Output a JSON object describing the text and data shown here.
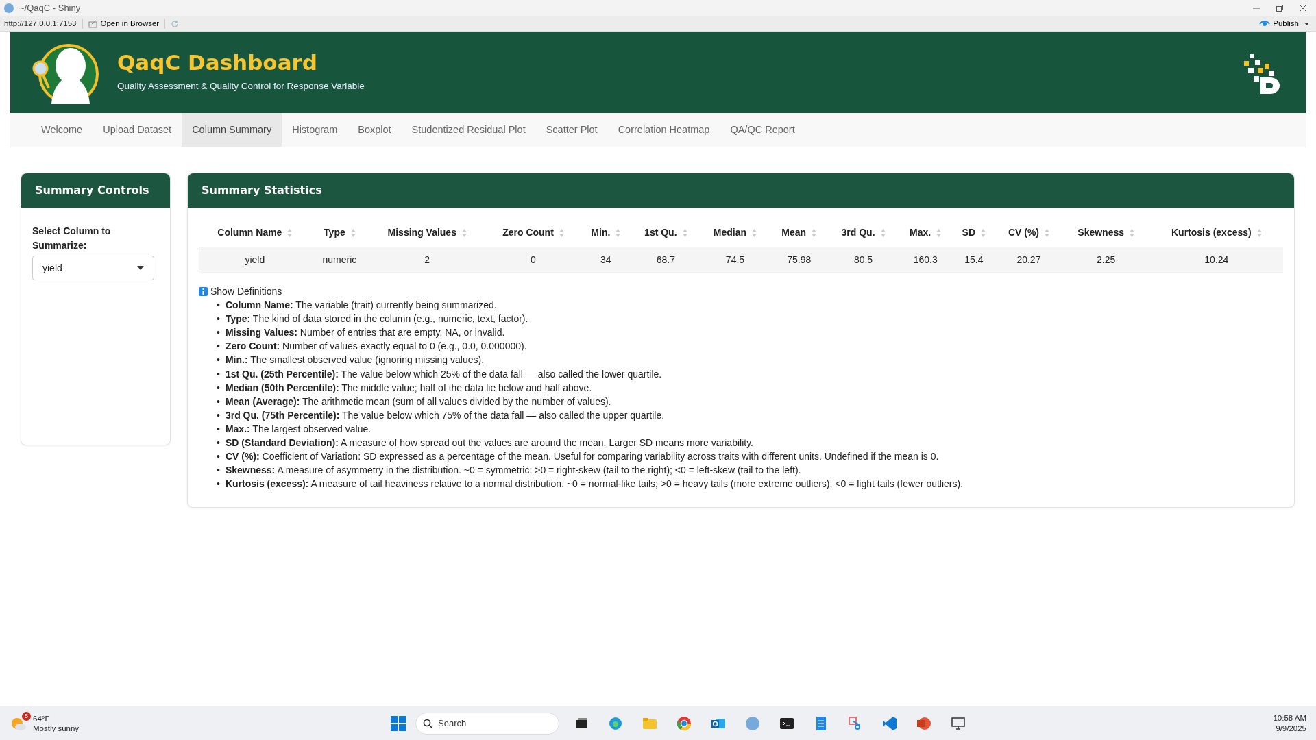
{
  "window": {
    "title": "~/QaqC - Shiny",
    "url": "http://127.0.0.1:7153",
    "open_in_browser": "Open in Browser",
    "publish": "Publish"
  },
  "header": {
    "title": "QaqC Dashboard",
    "subtitle": "Quality Assessment & Quality Control for Response Variable"
  },
  "tabs": [
    {
      "label": "Welcome",
      "selected": false
    },
    {
      "label": "Upload Dataset",
      "selected": false
    },
    {
      "label": "Column Summary",
      "selected": true
    },
    {
      "label": "Histogram",
      "selected": false
    },
    {
      "label": "Boxplot",
      "selected": false
    },
    {
      "label": "Studentized Residual Plot",
      "selected": false
    },
    {
      "label": "Scatter Plot",
      "selected": false
    },
    {
      "label": "Correlation Heatmap",
      "selected": false
    },
    {
      "label": "QA/QC Report",
      "selected": false
    }
  ],
  "sidebar": {
    "title": "Summary Controls",
    "field_label": "Select Column to Summarize:",
    "select_value": "yield"
  },
  "main": {
    "title": "Summary Statistics",
    "table": {
      "columns": [
        "Column Name",
        "Type",
        "Missing Values",
        "Zero Count",
        "Min.",
        "1st Qu.",
        "Median",
        "Mean",
        "3rd Qu.",
        "Max.",
        "SD",
        "CV (%)",
        "Skewness",
        "Kurtosis (excess)"
      ],
      "rows": [
        [
          "yield",
          "numeric",
          "2",
          "0",
          "34",
          "68.7",
          "74.5",
          "75.98",
          "80.5",
          "160.3",
          "15.4",
          "20.27",
          "2.25",
          "10.24"
        ]
      ]
    },
    "definitions": {
      "toggle": "Show Definitions",
      "bullet": "•",
      "items": [
        "**Column Name:** The variable (trait) currently being summarized.",
        "**Type:** The kind of data stored in the column (e.g., numeric, text, factor).",
        "**Missing Values:** Number of entries that are empty, NA, or invalid.",
        "**Zero Count:** Number of values exactly equal to 0 (e.g., 0.0, 0.000000).",
        "**Min.:** The smallest observed value (ignoring missing values).",
        "**1st Qu. (25th Percentile):** The value below which 25% of the data fall — also called the lower quartile.",
        "**Median (50th Percentile):** The middle value; half of the data lie below and half above.",
        "**Mean (Average):** The arithmetic mean (sum of all values divided by the number of values).",
        "**3rd Qu. (75th Percentile):** The value below which 75% of the data fall — also called the upper quartile.",
        "**Max.:** The largest observed value.",
        "**SD (Standard Deviation):** A measure of how spread out the values are around the mean. Larger SD means more variability.",
        "**CV (%):** Coefficient of Variation: SD expressed as a percentage of the mean. Useful for comparing variability across traits with different units. Undefined if the mean is 0.",
        "**Skewness:** A measure of asymmetry in the distribution. ~0 = symmetric; >0 = right-skew (tail to the right); <0 = left-skew (tail to the left).",
        "**Kurtosis (excess):** A measure of tail heaviness relative to a normal distribution. ~0 = normal-like tails; >0 = heavy tails (more extreme outliers); <0 = light tails (fewer outliers)."
      ]
    }
  },
  "taskbar": {
    "weather_badge": "5",
    "temperature": "64°F",
    "condition": "Mostly sunny",
    "search_placeholder": "Search",
    "time": "10:58 AM",
    "date": "9/9/2025"
  }
}
